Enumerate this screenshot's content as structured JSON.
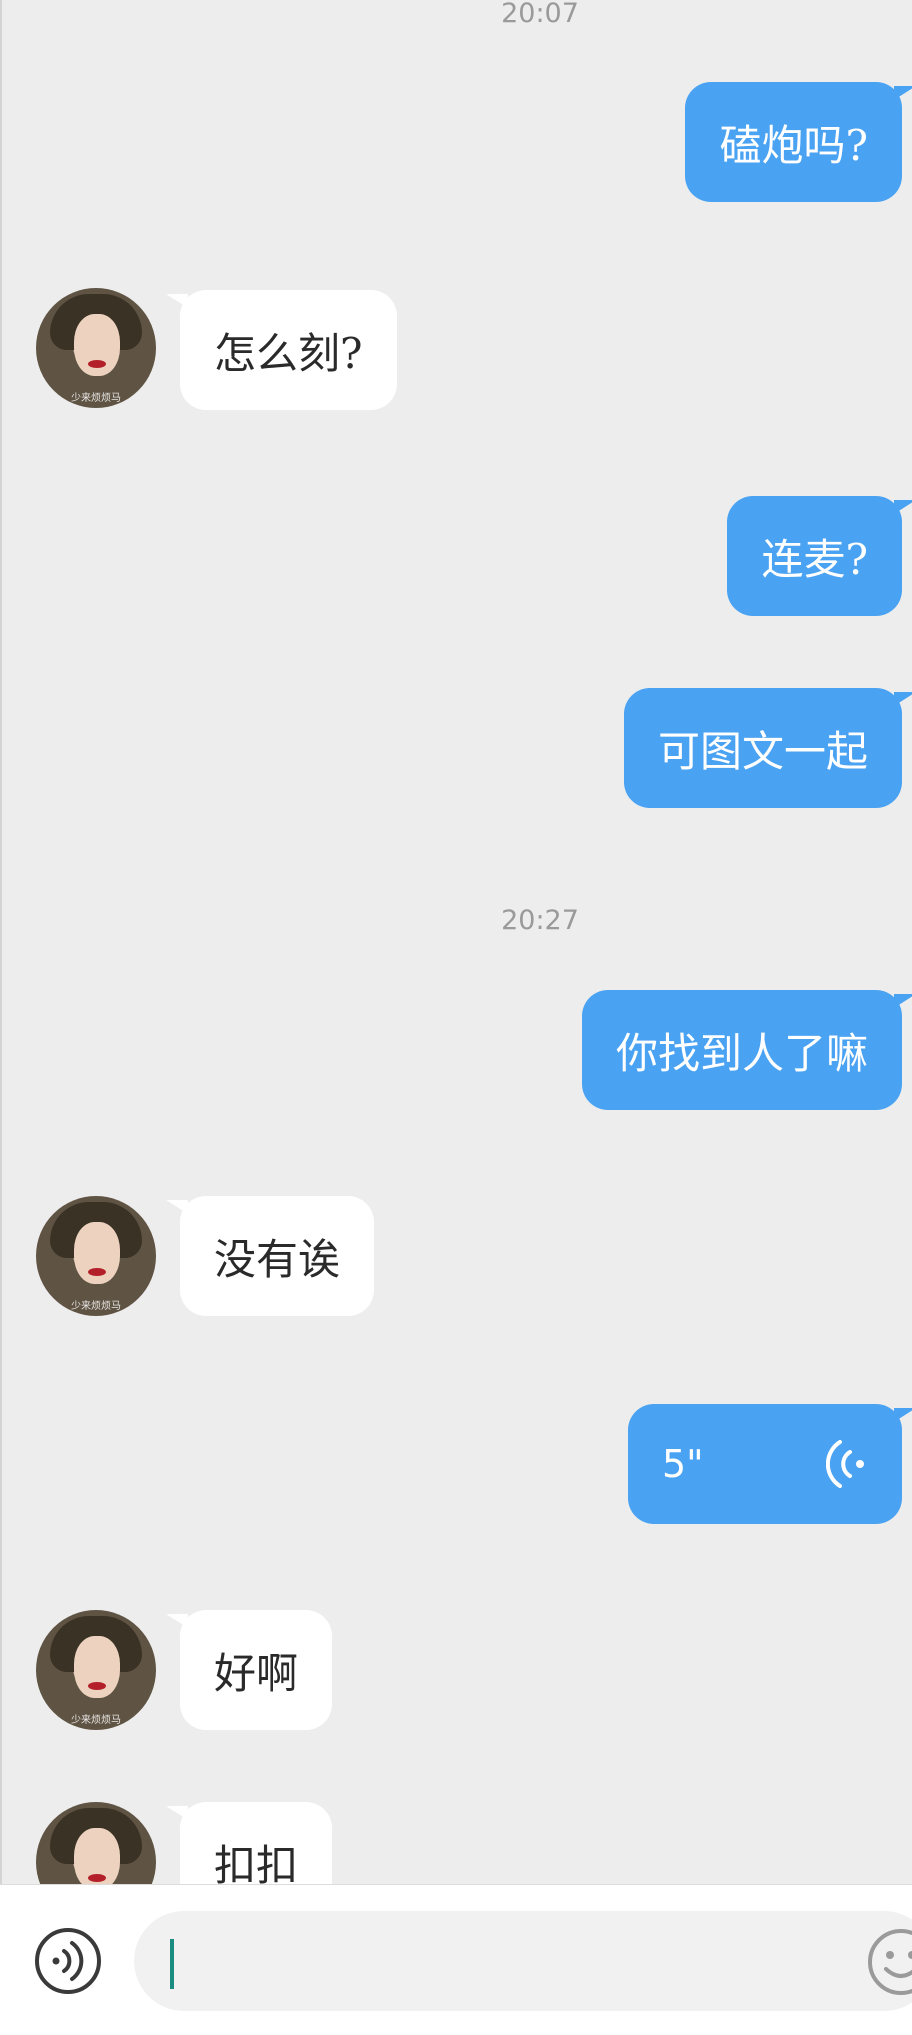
{
  "chat": {
    "timestamps": [
      "20:07",
      "20:27"
    ],
    "messages": {
      "m1": "磕炮吗?",
      "m2": "怎么刻?",
      "m3": "连麦?",
      "m4": "可图文一起",
      "m5": "你找到人了嘛",
      "m6": "没有诶",
      "m7_voice_duration": "5\"",
      "m8": "好啊",
      "m9": "扣扣"
    },
    "avatar_watermark": "少来烦烦马"
  },
  "input_bar": {
    "value": "",
    "voice_icon": "voice-input-icon",
    "emoji_icon": "emoji-icon"
  },
  "colors": {
    "background": "#ededed",
    "outgoing_bubble": "#4aa2f2",
    "incoming_bubble": "#ffffff",
    "caret": "#1a8c80"
  }
}
